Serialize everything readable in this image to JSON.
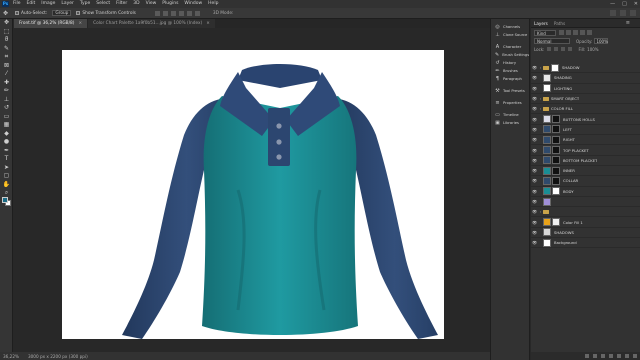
{
  "menubar": {
    "logo": "Ps",
    "items": [
      "File",
      "Edit",
      "Image",
      "Layer",
      "Type",
      "Select",
      "Filter",
      "3D",
      "View",
      "Plugins",
      "Window",
      "Help"
    ],
    "win": [
      "—",
      "□",
      "✕"
    ]
  },
  "options": {
    "auto_select": "Auto-Select:",
    "auto_select_value": "Group",
    "transform": "Show Transform Controls",
    "mode3d": "3D Mode:"
  },
  "tabs": [
    {
      "label": "Front.tif @ 36,2% (RGB/8)",
      "active": true
    },
    {
      "label": "Color Chart Palette 1a9f0b51...jpg @ 100% (Index)",
      "active": false
    }
  ],
  "statusbar": {
    "zoom": "36,22%",
    "info": "3000 px x 2200 px (300 ppi)"
  },
  "midpanel": {
    "group1": [
      "Channels",
      "Clone Source"
    ],
    "group2": [
      "Character",
      "Brush Settings",
      "History",
      "Brushes",
      "Paragraph"
    ],
    "group3": [
      "Tool Presets"
    ],
    "group4": [
      "Properties"
    ],
    "group5": [
      "Timeline",
      "Libraries"
    ]
  },
  "layers_panel": {
    "tabs": [
      "Layers",
      "Paths"
    ],
    "filter_kind": "Kind",
    "blend_mode": "Normal",
    "opacity_label": "Opacity:",
    "opacity": "100%",
    "lock_label": "Lock:",
    "fill_label": "Fill:",
    "fill": "100%",
    "rows": [
      {
        "name": "SHADOW",
        "type": "group",
        "thumb": "#ffffff",
        "mask": ""
      },
      {
        "name": "SHADING",
        "type": "layer",
        "thumb": "#e8e8e8",
        "mask": ""
      },
      {
        "name": "LIGHTING",
        "type": "layer",
        "thumb": "#ffffff",
        "mask": ""
      },
      {
        "name": "SMART OBJECT",
        "type": "group",
        "thumb": "",
        "mask": ""
      },
      {
        "name": "COLOR FILL",
        "type": "group",
        "thumb": "",
        "mask": ""
      },
      {
        "name": "BUTTONS HOLLS",
        "type": "layer",
        "thumb": "#dcdce8",
        "mask": "#111111"
      },
      {
        "name": "LEFT",
        "type": "layer",
        "thumb": "#2f4a6c",
        "mask": "#111111"
      },
      {
        "name": "RIGHT",
        "type": "layer",
        "thumb": "#2f4a6c",
        "mask": "#111111"
      },
      {
        "name": "TOP PLACKET",
        "type": "layer",
        "thumb": "#2f4a6c",
        "mask": "#111111"
      },
      {
        "name": "BOTTOM PLACKET",
        "type": "layer",
        "thumb": "#2f4a6c",
        "mask": "#111111"
      },
      {
        "name": "INNER",
        "type": "layer",
        "thumb": "#1a8e95",
        "mask": "#111111"
      },
      {
        "name": "COLLAR",
        "type": "layer",
        "thumb": "#2f4a6c",
        "mask": "#111111"
      },
      {
        "name": "BODY",
        "type": "layer",
        "thumb": "#1a8e95",
        "mask": "#ffffff"
      },
      {
        "name": "",
        "type": "layer",
        "thumb": "#9f8fd8",
        "mask": ""
      },
      {
        "name": "",
        "type": "group",
        "thumb": "",
        "mask": ""
      },
      {
        "name": "Color Fill 1",
        "type": "layer",
        "thumb": "#e8a21a",
        "mask": "#f0f0f0"
      },
      {
        "name": "SHADOWS",
        "type": "layer",
        "thumb": "#d8d8d8",
        "mask": ""
      },
      {
        "name": "Background",
        "type": "layer",
        "thumb": "#ffffff",
        "mask": ""
      }
    ]
  },
  "colors": {
    "shirt_body": "#1a8e95",
    "shirt_sleeves": "#2c4670",
    "foreground": "#1c6c86",
    "background": "#ffffff"
  }
}
